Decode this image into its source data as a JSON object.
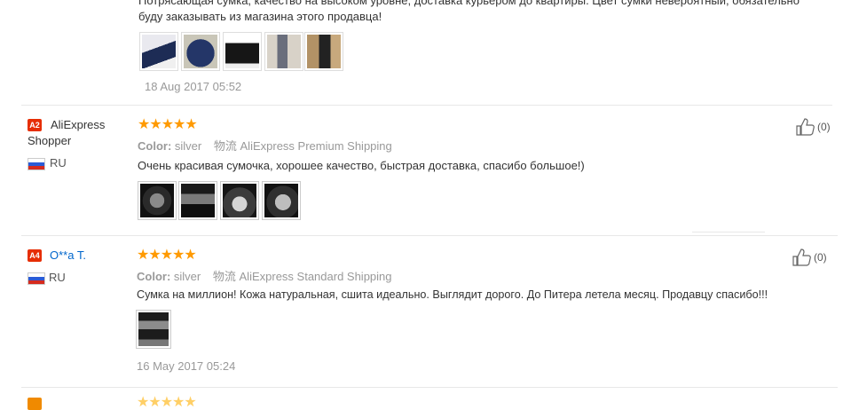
{
  "review1": {
    "text_line1": "Потрясающая сумка, качество на высоком уровне, доставка курьером до квартиры. Цвет сумки невероятный, обязательно",
    "text_line2": "буду заказывать из магазина этого продавца!",
    "date": "18 Aug 2017 05:52"
  },
  "review2": {
    "badge": "A2",
    "name_line1": "AliExpress",
    "name_line2": "Shopper",
    "country": "RU",
    "stars": "★★★★★",
    "color_label": "Color:",
    "color_value": "silver",
    "ship_label": "物流",
    "ship_value": "AliExpress Premium Shipping",
    "text": "Очень красивая сумочка, хорошее качество, быстрая доставка, спасибо большое!)",
    "likes": "(0)"
  },
  "review3": {
    "badge": "A4",
    "name": "O**a T.",
    "country": "RU",
    "stars": "★★★★★",
    "color_label": "Color:",
    "color_value": "silver",
    "ship_label": "物流",
    "ship_value": "AliExpress Standard Shipping",
    "text": "Сумка на миллион! Кожа натуральная, сшита идеально. Выглядит дорого. До Питера летела месяц. Продавцу спасибо!!!",
    "date": "16 May 2017 05:24",
    "likes": "(0)"
  },
  "colors": {
    "accent": "#e62e04",
    "star": "#ff9a00",
    "link": "#0066cc"
  },
  "icons": {
    "like": "thumbs-up-icon",
    "flag": "russia-flag-icon"
  }
}
